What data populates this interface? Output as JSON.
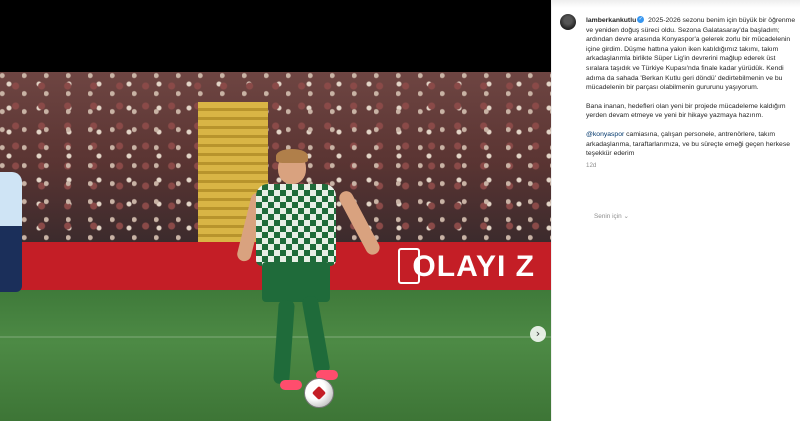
{
  "media": {
    "banner_text": "OLAYI Z",
    "next_icon": "chevron-right-icon",
    "next_glyph": "›"
  },
  "caption": {
    "username": "lamberkankutlu",
    "verified_glyph": "✓",
    "paragraph1": "2025-2026 sezonu benim için büyük bir öğrenme ve yeniden doğuş süreci oldu. Sezona Galatasaray'da başladım; ardından devre arasında Konyaspor'a gelerek zorlu bir mücadelenin içine girdim. Düşme hattına yakın iken katıldığımız takımı, takım arkadaşlarımla birlikte Süper Lig'in devrerini mağlup ederek üst sıralara taşıdık ve Türkiye Kupası'nda finale kadar yürüdük. Kendi adıma da sahada 'Berkan Kutlu geri döndü' dedirtebilmenin ve bu mücadelenin bir parçası olabilmenin gururunu yaşıyorum.",
    "paragraph2": "Bana inanan, hedefleri olan yeni bir projede mücadeleme kaldığım yerden devam etmeye ve yeni bir hikaye yazmaya hazırım.",
    "mention": "@konyaspor",
    "paragraph3": " camiasına, çalışan personele, antrenörlere, takım arkadaşlarıma, taraftarlarımıza, ve bu süreçte emeği geçen herkese teşekkür ederim",
    "timestamp": "12d",
    "translate_label": "Senin için ⌄"
  }
}
